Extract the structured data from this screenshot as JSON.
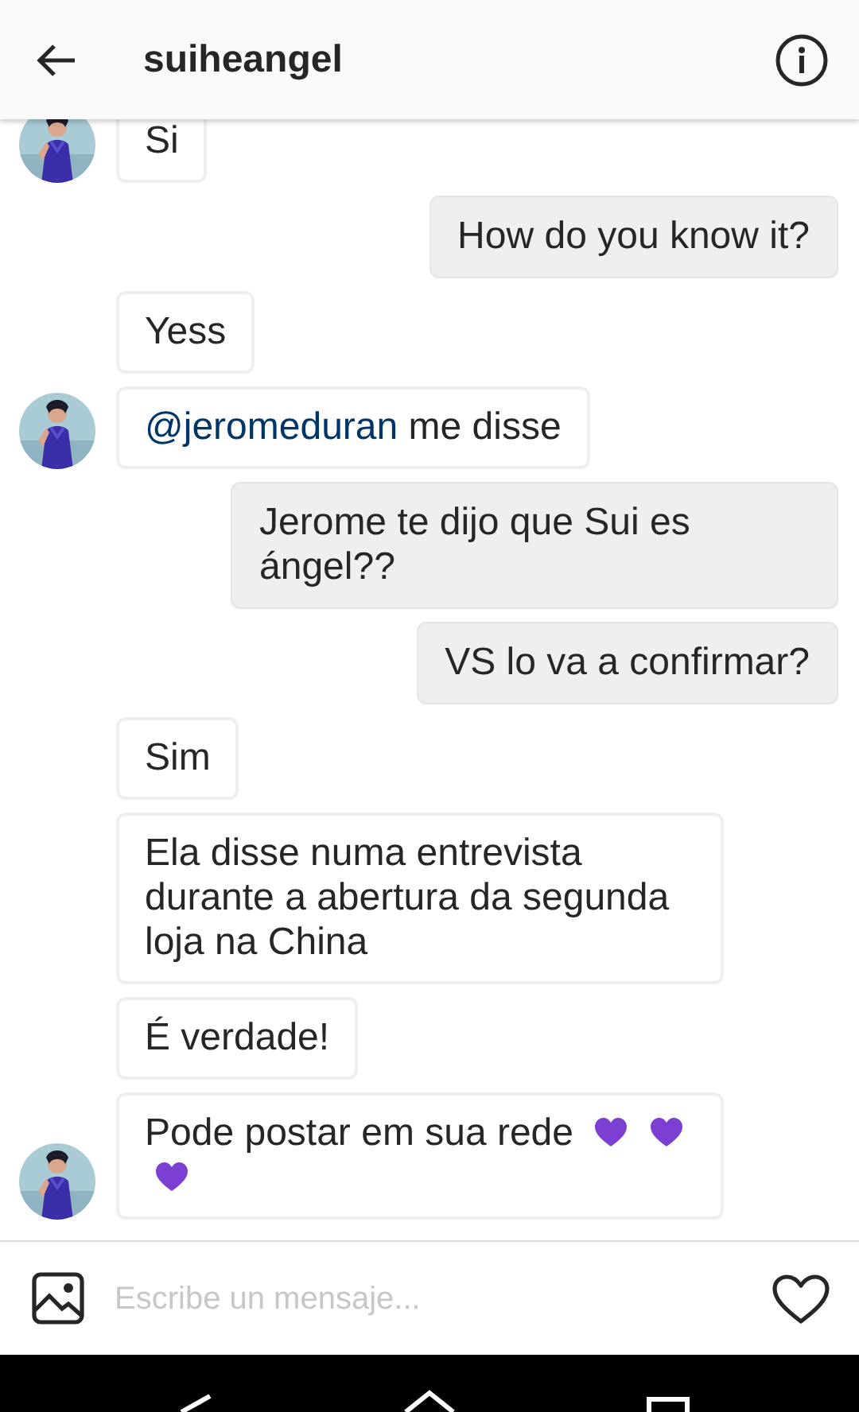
{
  "header": {
    "title": "suiheangel"
  },
  "messages": [
    {
      "kind": "received",
      "avatar": true,
      "text": "Si"
    },
    {
      "kind": "sent",
      "avatar": false,
      "text": "How do you know it?"
    },
    {
      "kind": "received",
      "avatar": false,
      "text": "Yess"
    },
    {
      "kind": "received",
      "avatar": true,
      "mention": "@jeromeduran",
      "text": "me disse"
    },
    {
      "kind": "sent",
      "avatar": false,
      "text": "Jerome te dijo que Sui es ángel??"
    },
    {
      "kind": "sent",
      "avatar": false,
      "text": "VS lo va a confirmar?"
    },
    {
      "kind": "received",
      "avatar": false,
      "text": "Sim"
    },
    {
      "kind": "received",
      "avatar": false,
      "text": "Ela disse numa entrevista durante a abertura da segunda loja na China"
    },
    {
      "kind": "received",
      "avatar": false,
      "text": "É verdade!"
    },
    {
      "kind": "received",
      "avatar": true,
      "text": "Pode postar em sua rede",
      "icons": [
        {
          "kind": "purple-heart"
        },
        {
          "kind": "purple-heart"
        },
        {
          "kind": "purple-heart"
        }
      ]
    }
  ],
  "composer": {
    "placeholder": "Escribe un mensaje..."
  }
}
